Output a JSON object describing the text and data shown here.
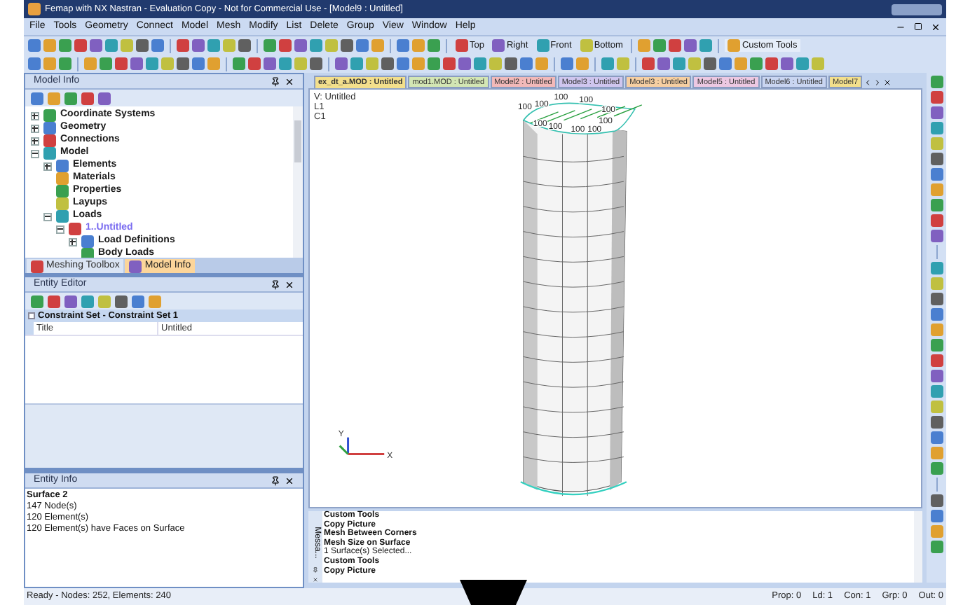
{
  "window": {
    "title": "Femap with NX Nastran - Evaluation Copy - Not for Commercial Use - [Model9 : Untitled]"
  },
  "menu": [
    "File",
    "Tools",
    "Geometry",
    "Connect",
    "Model",
    "Mesh",
    "Modify",
    "List",
    "Delete",
    "Group",
    "View",
    "Window",
    "Help"
  ],
  "view_buttons": [
    "Top",
    "Right",
    "Front",
    "Bottom"
  ],
  "custom_tools": "Custom Tools",
  "model_info": {
    "title": "Model Info",
    "tree": [
      {
        "label": "Coordinate Systems",
        "leaf": false,
        "expanded": false,
        "active": false
      },
      {
        "label": "Geometry",
        "leaf": false,
        "expanded": false,
        "active": false
      },
      {
        "label": "Connections",
        "leaf": false,
        "expanded": false,
        "active": false
      },
      {
        "label": "Model",
        "leaf": false,
        "expanded": true,
        "active": false,
        "children": [
          {
            "label": "Elements",
            "leaf": false,
            "expanded": false,
            "active": false
          },
          {
            "label": "Materials",
            "leaf": true,
            "active": false
          },
          {
            "label": "Properties",
            "leaf": true,
            "active": false
          },
          {
            "label": "Layups",
            "leaf": true,
            "active": false
          },
          {
            "label": "Loads",
            "leaf": false,
            "expanded": true,
            "active": false,
            "children": [
              {
                "label": "1..Untitled",
                "leaf": false,
                "expanded": true,
                "active": true,
                "children": [
                  {
                    "label": "Load Definitions",
                    "leaf": false,
                    "expanded": false,
                    "active": false
                  },
                  {
                    "label": "Body Loads",
                    "leaf": true,
                    "active": false
                  }
                ]
              }
            ]
          }
        ]
      }
    ]
  },
  "panel_tabs": [
    {
      "label": "Meshing Toolbox",
      "selected": false
    },
    {
      "label": "Model Info",
      "selected": true
    }
  ],
  "entity_editor": {
    "title": "Entity Editor",
    "group": "Constraint Set - Constraint Set 1",
    "rows": [
      {
        "name": "Title",
        "value": "Untitled"
      }
    ]
  },
  "entity_info": {
    "title": "Entity Info",
    "lines": [
      {
        "text": "Surface 2",
        "bold": true
      },
      {
        "text": "147 Node(s)",
        "bold": false
      },
      {
        "text": "120 Element(s)",
        "bold": false
      },
      {
        "text": "120 Element(s) have Faces on Surface",
        "bold": false
      }
    ]
  },
  "model_tabs": [
    {
      "label": "ex_dt_a.MOD : Untitled",
      "color": "#f3df8c",
      "selected": true
    },
    {
      "label": "mod1.MOD : Untitled",
      "color": "#d3e6b4",
      "selected": false
    },
    {
      "label": "Model2 : Untitled",
      "color": "#f2b9b9",
      "selected": false
    },
    {
      "label": "Model3 : Untitled",
      "color": "#cfc6ef",
      "selected": false
    },
    {
      "label": "Model3 : Untitled",
      "color": "#f6cfa2",
      "selected": false
    },
    {
      "label": "Model5 : Untitled",
      "color": "#ecc8e2",
      "selected": false
    },
    {
      "label": "Model6 : Untitled",
      "color": "#c9d5f1",
      "selected": false
    },
    {
      "label": "Model7",
      "color": "#f3df8c",
      "selected": false
    }
  ],
  "viewport": {
    "info": [
      "V: Untitled",
      "L1",
      "C1"
    ],
    "load_labels": [
      "100",
      "100",
      "100",
      "100",
      "100",
      "100",
      "100",
      "100",
      "100",
      "100"
    ],
    "axes": [
      "Y",
      "X"
    ]
  },
  "messages": {
    "title": "Messa...",
    "lines": [
      {
        "text": "Custom Tools",
        "bold": true
      },
      {
        "text": "Copy Picture",
        "bold": true
      },
      {
        "text": "Mesh Between Corners",
        "bold": true
      },
      {
        "text": "Mesh Size on Surface",
        "bold": true
      },
      {
        "text": "1 Surface(s) Selected...",
        "bold": false
      },
      {
        "text": "Custom Tools",
        "bold": true
      },
      {
        "text": "Copy Picture",
        "bold": true
      }
    ]
  },
  "status": {
    "text": "Ready - Nodes: 252,  Elements: 240",
    "fields": [
      "Prop: 0",
      "Ld: 1",
      "Con: 1",
      "Grp: 0",
      "Out: 0"
    ]
  }
}
